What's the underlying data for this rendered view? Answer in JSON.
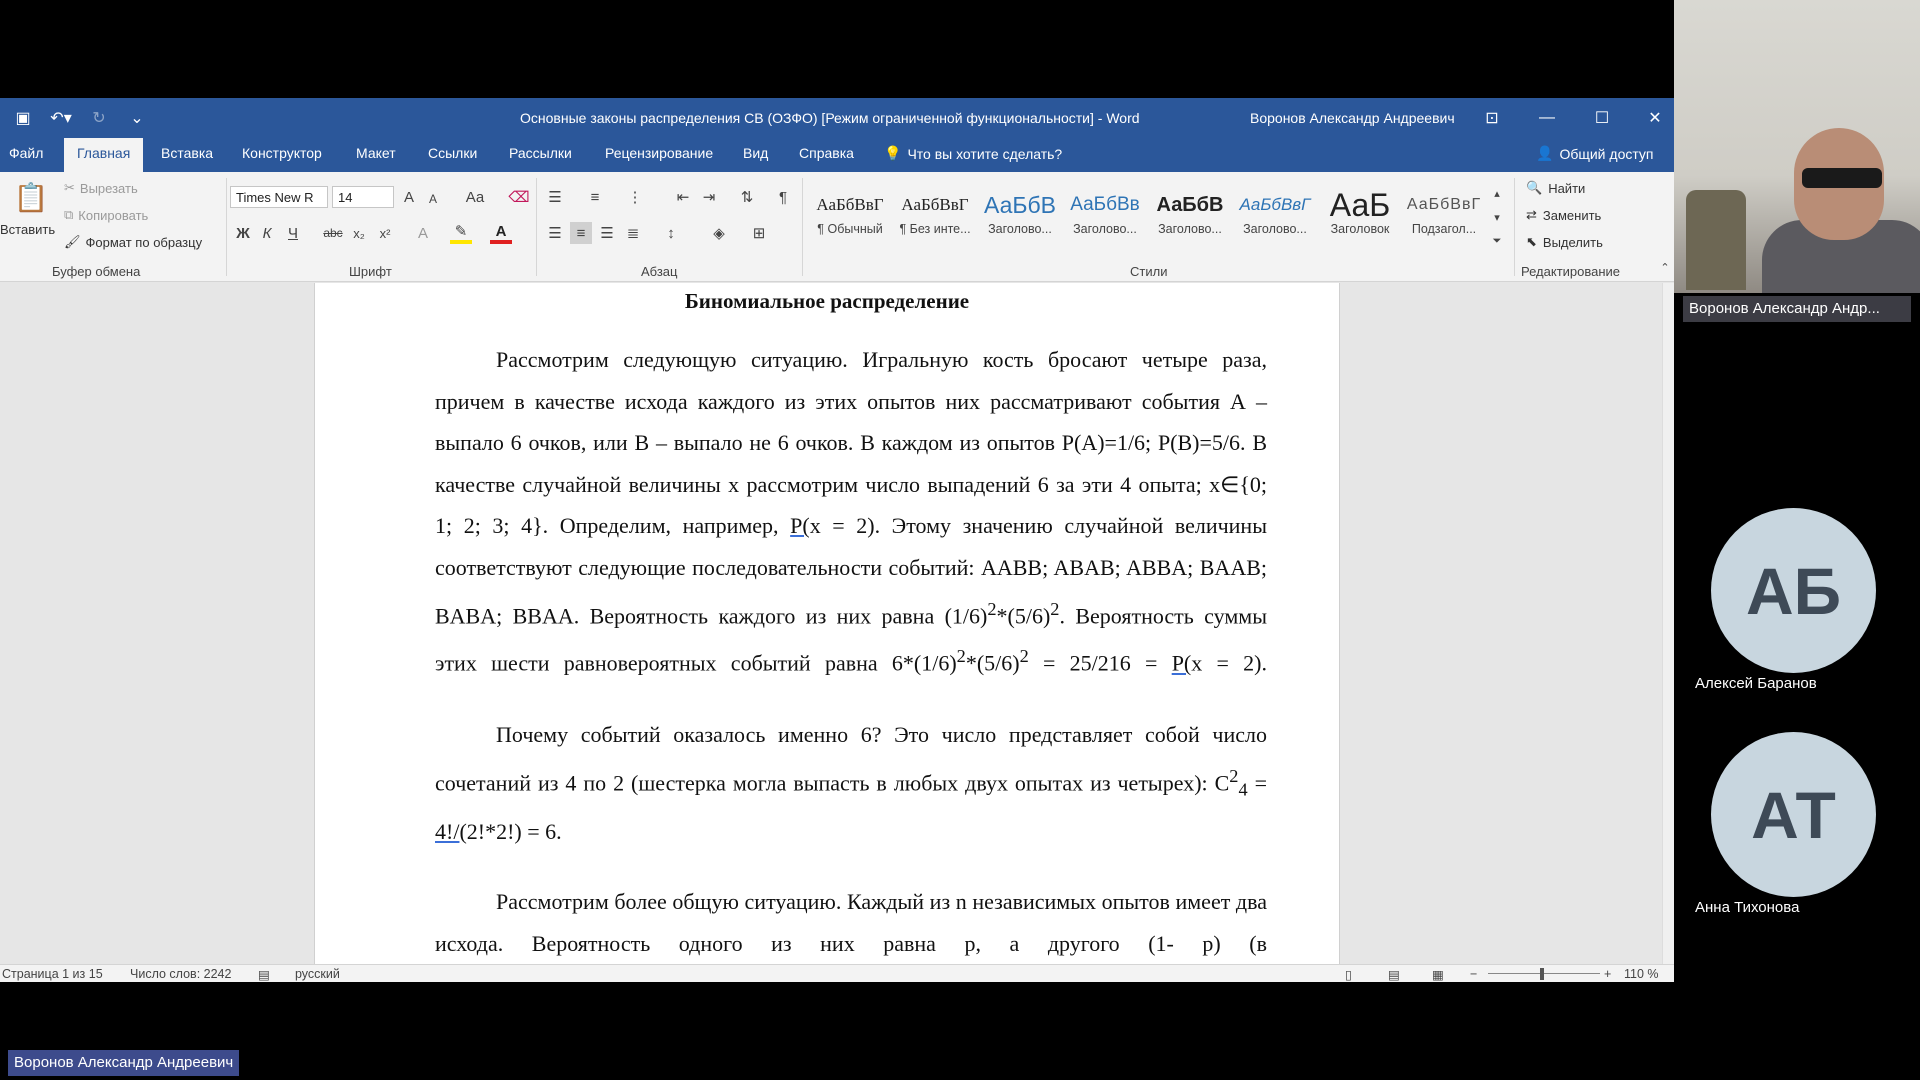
{
  "window": {
    "title": "Основные законы распределения СВ (ОЗФО) [Режим ограниченной функциональности]  -  Word",
    "user": "Воронов Александр Андреевич"
  },
  "ribbon_tabs": [
    "Файл",
    "Главная",
    "Вставка",
    "Конструктор",
    "Макет",
    "Ссылки",
    "Рассылки",
    "Рецензирование",
    "Вид",
    "Справка"
  ],
  "tell_me": "Что вы хотите сделать?",
  "share": "Общий доступ",
  "clipboard": {
    "paste": "Вставить",
    "cut": "Вырезать",
    "copy": "Копировать",
    "format_painter": "Формат по образцу",
    "group": "Буфер обмена"
  },
  "font": {
    "name": "Times New R",
    "size": "14",
    "group": "Шрифт",
    "bold": "Ж",
    "italic": "К",
    "underline": "Ч",
    "strike": "abc",
    "subscript": "x₂",
    "superscript": "x²",
    "change_case": "Аа",
    "grow": "A",
    "shrink": "A",
    "font_color": "A",
    "text_effects": "A"
  },
  "paragraph": {
    "group": "Абзац"
  },
  "styles": {
    "group": "Стили",
    "items": [
      {
        "preview": "АаБбВвГ",
        "name": "¶ Обычный"
      },
      {
        "preview": "АаБбВвГ",
        "name": "¶ Без инте..."
      },
      {
        "preview": "АаБбВ",
        "name": "Заголово..."
      },
      {
        "preview": "АаБбВв",
        "name": "Заголово..."
      },
      {
        "preview": "АаБбВ",
        "name": "Заголово..."
      },
      {
        "preview": "АаБбВвГ",
        "name": "Заголово..."
      },
      {
        "preview": "АаБ",
        "name": "Заголовок"
      },
      {
        "preview": "АаБбВвГ",
        "name": "Подзагол..."
      }
    ]
  },
  "editing": {
    "find": "Найти",
    "replace": "Заменить",
    "select": "Выделить",
    "group": "Редактирование"
  },
  "document": {
    "heading": "Биномиальное распределение",
    "p1_line1": "Рассмотрим следующую ситуацию. Игральную кость бросают четыре раза, причем в качестве исхода каждого из этих опытов них рассматривают события А – выпало 6 очков, или В – выпало не 6 очков. В каждом из опытов Р(А)=1/6; Р(В)=5/6. В качестве случайной величины х рассмотрим число выпадений 6 за эти 4 опыта; х",
    "p1_in": "∈",
    "p1_set": "{0; 1; 2; 3; 4}. Определим, например, ",
    "p1_px2": "Р(",
    "p1_after_px2": "х = 2). Этому значению случайной величины соответствуют следующие последовательности событий: AABB; ABAB; ABBA; BAAB; BABA; BBAA. Вероятность каждого из них равна (1/6)",
    "sup2": "2",
    "p1_mid": "*(5/6)",
    "p1_mid2": ". Вероятность суммы этих шести равновероятных событий равна 6*(1/6)",
    "p1_mid3": "*(5/6)",
    "p1_end": " = 25/216 = ",
    "p1_px2b": "Р(",
    "p1_end2": "х = 2).",
    "p2_a": "Почему событий оказалось именно 6? Это число представляет собой число сочетаний из 4 по 2 (шестерка могла выпасть в любых двух опытах из четырех): С",
    "sub4": "4",
    "p2_eq": " = ",
    "p2_fact": "4!/",
    "p2_b": "(2!*2!) = 6.",
    "p3": "Рассмотрим более общую ситуацию. Каждый из n независимых опытов имеет два исхода. Вероятность одного из них равна р, а другого (1- р) (в"
  },
  "status": {
    "page": "Страница 1 из 15",
    "words": "Число слов: 2242",
    "language": "русский",
    "zoom": "110 %"
  },
  "participants": {
    "video_name": "Воронов Александр Андр...",
    "p1_initials": "АБ",
    "p1_name": "Алексей Баранов",
    "p2_initials": "АТ",
    "p2_name": "Анна Тихонова",
    "bottom_label": "Воронов Александр Андреевич"
  }
}
